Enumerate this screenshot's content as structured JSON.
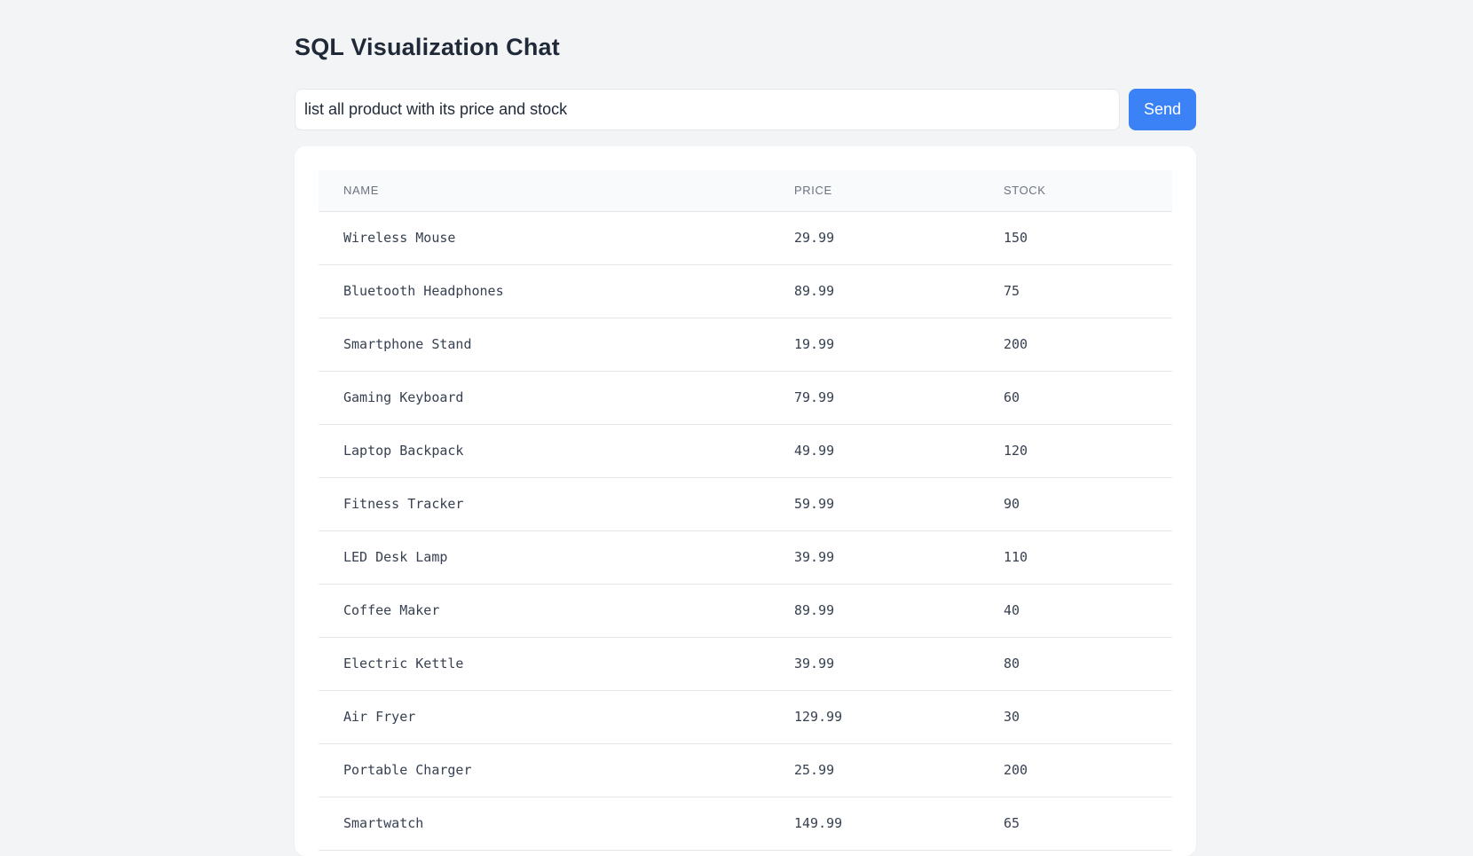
{
  "header": {
    "title": "SQL Visualization Chat"
  },
  "query": {
    "value": "list all product with its price and stock",
    "send_label": "Send"
  },
  "table": {
    "columns": [
      "NAME",
      "PRICE",
      "STOCK"
    ],
    "rows": [
      [
        "Wireless Mouse",
        "29.99",
        "150"
      ],
      [
        "Bluetooth Headphones",
        "89.99",
        "75"
      ],
      [
        "Smartphone Stand",
        "19.99",
        "200"
      ],
      [
        "Gaming Keyboard",
        "79.99",
        "60"
      ],
      [
        "Laptop Backpack",
        "49.99",
        "120"
      ],
      [
        "Fitness Tracker",
        "59.99",
        "90"
      ],
      [
        "LED Desk Lamp",
        "39.99",
        "110"
      ],
      [
        "Coffee Maker",
        "89.99",
        "40"
      ],
      [
        "Electric Kettle",
        "39.99",
        "80"
      ],
      [
        "Air Fryer",
        "129.99",
        "30"
      ],
      [
        "Portable Charger",
        "25.99",
        "200"
      ],
      [
        "Smartwatch",
        "149.99",
        "65"
      ]
    ]
  },
  "colors": {
    "background": "#f3f4f6",
    "accent": "#3b82f6",
    "card": "#ffffff",
    "header_row": "#f9fafb"
  }
}
